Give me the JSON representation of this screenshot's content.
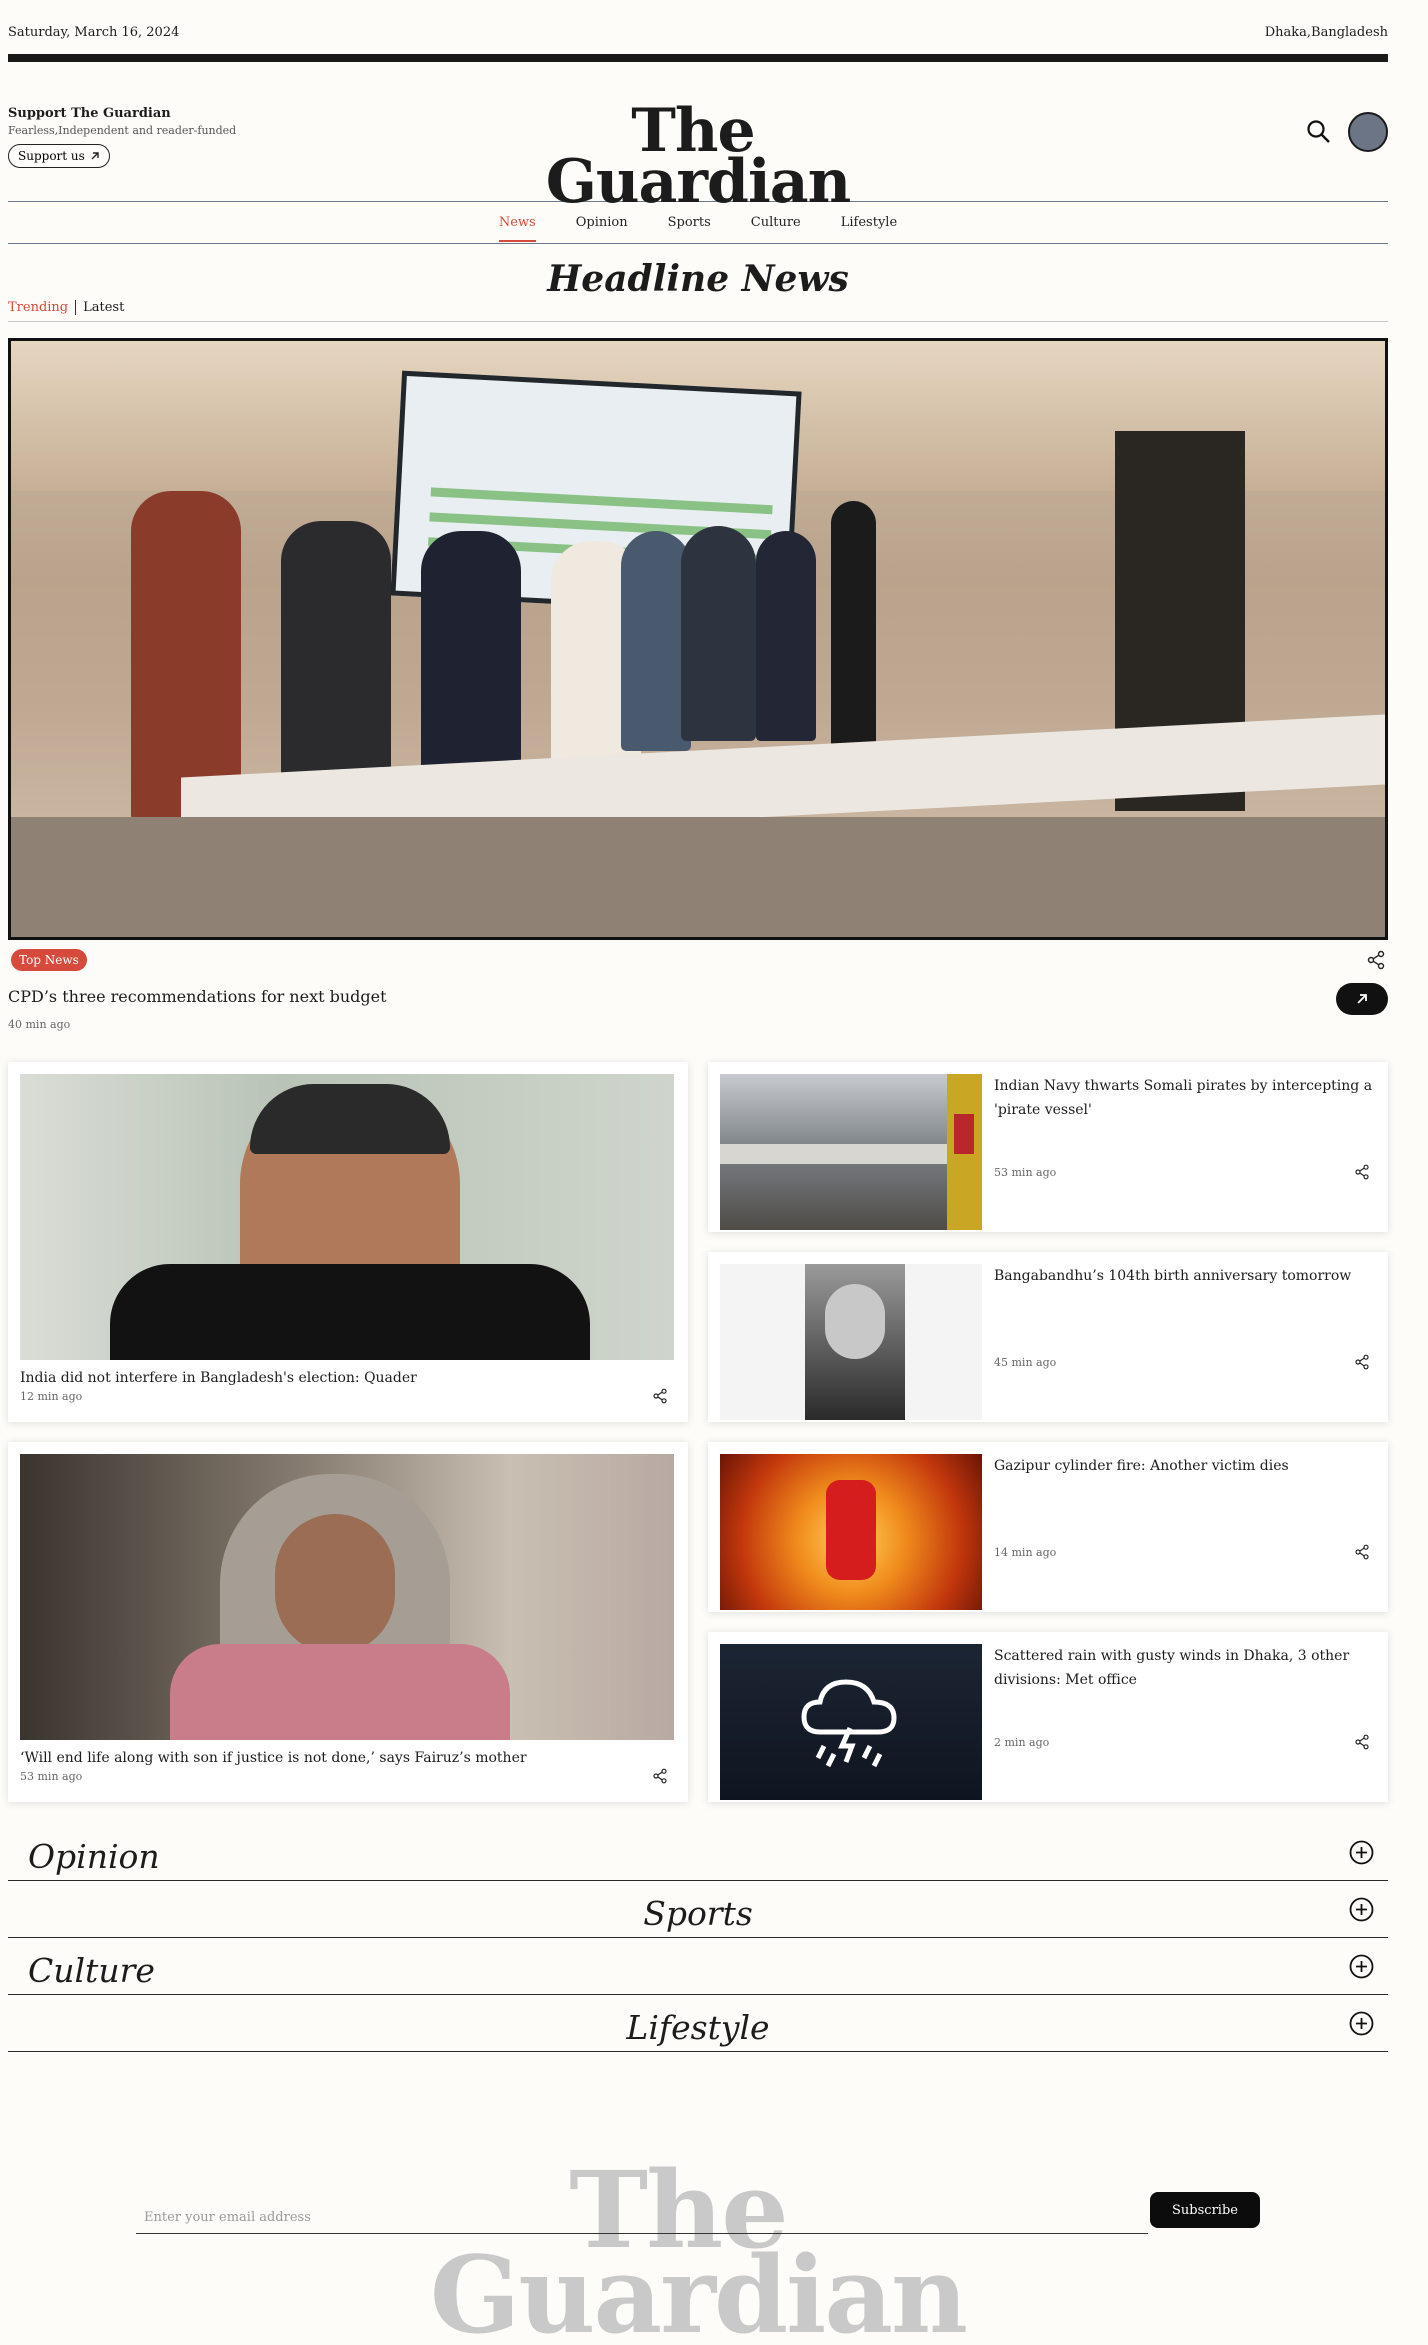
{
  "header": {
    "date": "Saturday, March 16, 2024",
    "location": "Dhaka,Bangladesh"
  },
  "support": {
    "title": "Support The Guardian",
    "tagline": "Fearless,Independent and reader-funded",
    "button_label": "Support us"
  },
  "logo": {
    "line1": "The",
    "line2": "Guardian"
  },
  "nav": {
    "items": [
      "News",
      "Opinion",
      "Sports",
      "Culture",
      "Lifestyle"
    ],
    "active": "News"
  },
  "headline": {
    "title": "Headline News",
    "filters": [
      "Trending",
      "Latest"
    ]
  },
  "hero": {
    "tag": "Top News",
    "title": "CPD’s three recommendations for next budget",
    "time": "40 min ago"
  },
  "articles": {
    "big": [
      {
        "title": "India did not interfere in Bangladesh's election: Quader",
        "time": "12 min ago"
      },
      {
        "title": "‘Will end life along with son if justice is not done,’ says Fairuz’s mother",
        "time": "53 min ago"
      }
    ],
    "small": [
      {
        "title": "Indian Navy thwarts Somali pirates by intercepting a 'pirate vessel'",
        "time": "53 min ago"
      },
      {
        "title": "Bangabandhu’s 104th birth anniversary tomorrow",
        "time": "45 min ago"
      },
      {
        "title": "Gazipur cylinder fire: Another victim dies",
        "time": "14 min ago"
      },
      {
        "title": "Scattered rain with gusty winds in Dhaka, 3 other divisions: Met office",
        "time": "2 min ago"
      }
    ]
  },
  "sections": [
    "Opinion",
    "Sports",
    "Culture",
    "Lifestyle"
  ],
  "footer": {
    "email_placeholder": "Enter your email address",
    "subscribe_label": "Subscribe",
    "logo_line1": "The",
    "logo_line2": "Guardian"
  },
  "colors": {
    "accent": "#d54a3a",
    "ink": "#1c1c1c",
    "background": "#fdfcf8"
  }
}
